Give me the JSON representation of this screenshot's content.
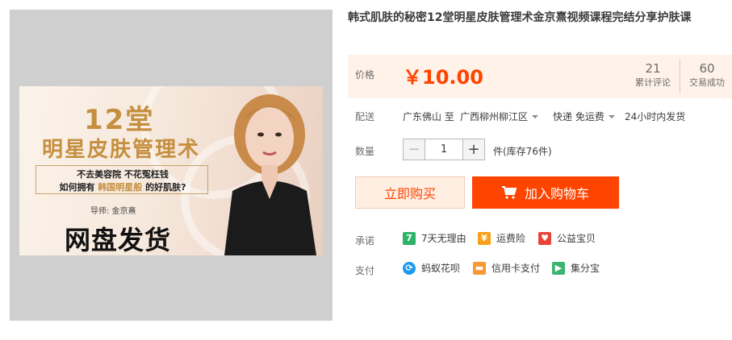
{
  "product": {
    "title": "韩式肌肤的秘密12堂明星皮肤管理术金京熹视频课程完结分享护肤课"
  },
  "banner": {
    "number": "12堂",
    "headline": "明星皮肤管理术",
    "line1": "不去美容院 不花冤枉钱",
    "line2_prefix": "如何拥有 ",
    "line2_highlight": "韩国明星般",
    "line2_suffix": " 的好肌肤?",
    "teacher": "导师: 金京熹",
    "shipping": "网盘发货"
  },
  "price": {
    "label": "价格",
    "value": "￥10.00",
    "reviews_count": "21",
    "reviews_label": "累计评论",
    "sales_count": "60",
    "sales_label": "交易成功"
  },
  "shipping": {
    "label": "配送",
    "origin": "广东佛山 至",
    "destination": "广西柳州柳江区",
    "method": "快递 免运费",
    "dispatch": "24小时内发货"
  },
  "quantity": {
    "label": "数量",
    "minus": "−",
    "value": "1",
    "plus": "+",
    "stock": "件(库存76件)"
  },
  "actions": {
    "buy_now": "立即购买",
    "add_to_cart": "加入购物车"
  },
  "promise": {
    "label": "承诺",
    "items": [
      {
        "icon": "seven-day-return-icon",
        "icon_text": "7",
        "text": "7天无理由",
        "color": "#2db36a"
      },
      {
        "icon": "shipping-insurance-icon",
        "icon_text": "¥",
        "text": "运费险",
        "color": "#f7a11a"
      },
      {
        "icon": "charity-icon",
        "icon_text": "♥",
        "text": "公益宝贝",
        "color": "#e8443a"
      }
    ]
  },
  "payment": {
    "label": "支付",
    "items": [
      {
        "icon": "huabei-icon",
        "icon_text": "⟳",
        "text": "蚂蚁花呗",
        "color": "#1e9bf0"
      },
      {
        "icon": "credit-card-icon",
        "icon_text": "▬",
        "text": "信用卡支付",
        "color": "#f79a33"
      },
      {
        "icon": "jifenbao-icon",
        "icon_text": "▶",
        "text": "集分宝",
        "color": "#3cb371"
      }
    ]
  },
  "colors": {
    "accent": "#ff4400",
    "price_bg": "#fff2e8",
    "gold": "#c58f3f"
  }
}
